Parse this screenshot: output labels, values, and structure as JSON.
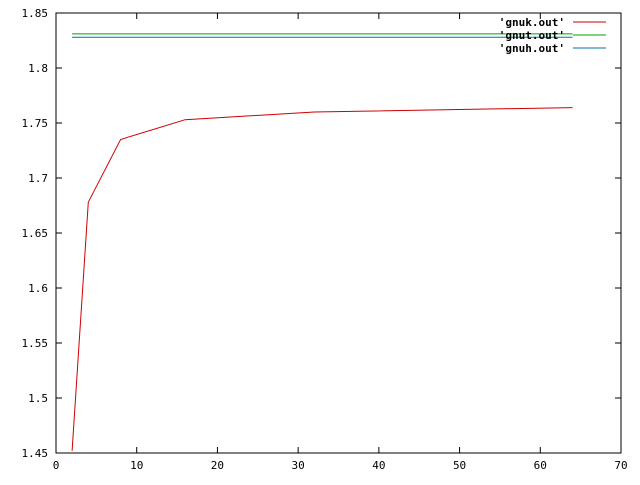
{
  "chart_data": {
    "type": "line",
    "title": "",
    "xlabel": "",
    "ylabel": "",
    "xlim": [
      0,
      70
    ],
    "ylim": [
      1.45,
      1.85
    ],
    "x_ticks": [
      0,
      10,
      20,
      30,
      40,
      50,
      60,
      70
    ],
    "x_tick_labels": [
      "0",
      "10",
      "20",
      "30",
      "40",
      "50",
      "60",
      "70"
    ],
    "y_ticks": [
      1.45,
      1.5,
      1.55,
      1.6,
      1.65,
      1.7,
      1.75,
      1.8,
      1.85
    ],
    "y_tick_labels": [
      "1.45",
      "1.5",
      "1.55",
      "1.6",
      "1.65",
      "1.7",
      "1.75",
      "1.8",
      "1.85"
    ],
    "grid": false,
    "legend_position": "top-right",
    "series": [
      {
        "name": "'gnuk.out'",
        "color": "#cc0000",
        "x": [
          2,
          4,
          8,
          16,
          32,
          64
        ],
        "y": [
          1.452,
          1.678,
          1.735,
          1.753,
          1.76,
          1.764
        ]
      },
      {
        "name": "'gnut.out'",
        "color": "#00a000",
        "x": [
          2,
          64
        ],
        "y": [
          1.831,
          1.831
        ]
      },
      {
        "name": "'gnuh.out'",
        "color": "#0070b0",
        "x": [
          2,
          64
        ],
        "y": [
          1.828,
          1.828
        ]
      }
    ]
  }
}
